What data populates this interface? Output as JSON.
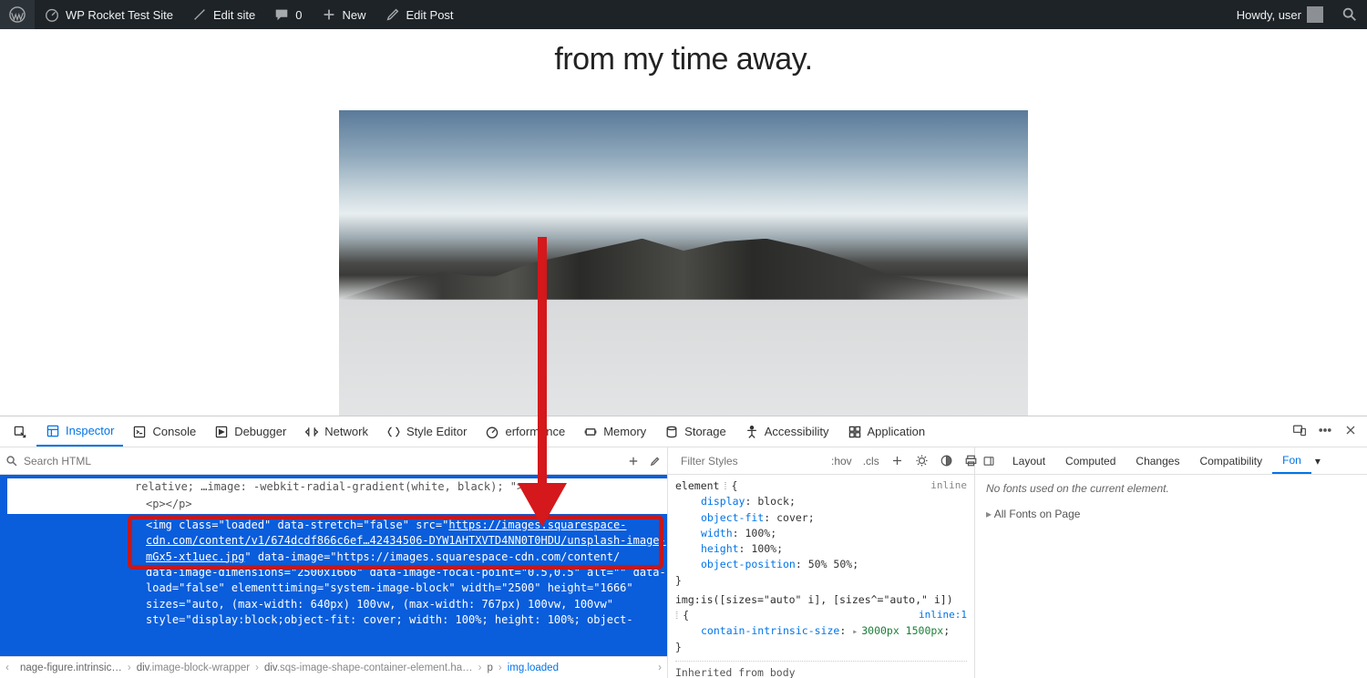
{
  "admin_bar": {
    "site_name": "WP Rocket Test Site",
    "edit_site": "Edit site",
    "comments_count": "0",
    "new_label": "New",
    "edit_post": "Edit Post",
    "howdy": "Howdy, user"
  },
  "page": {
    "headline": "from my time away."
  },
  "devtools": {
    "tabs": [
      "Inspector",
      "Console",
      "Debugger",
      "Network",
      "Style Editor",
      "erformance",
      "Memory",
      "Storage",
      "Accessibility",
      "Application"
    ],
    "active_tab": "Inspector",
    "search_placeholder": "Search HTML",
    "html_lines": {
      "prefix_line": "relative; …image: -webkit-radial-gradient(white, black); \">",
      "pline": "<p></p>",
      "sel_l1a": "<img class=\"loaded\" data-stretch=\"false\" src=\"",
      "sel_url1": "https://images.squarespace-cdn.com/content/v1/674dcdf866c6ef…42434506-DYW1AHTXVTD4NN0T0HDU/unsplash-image-mGx5-xt1uec.jpg",
      "sel_l1b": "\" data-image=\"https://images.squarespace-cdn.com/content/",
      "tail_l1": "data-image-dimensions=\"2500x1666\" data-image-focal-point=\"0.5,0.5\" alt=\"\" data-",
      "tail_l2": "load=\"false\" elementtiming=\"system-image-block\" width=\"2500\" height=\"1666\"",
      "tail_l3": "sizes=\"auto, (max-width: 640px) 100vw, (max-width: 767px) 100vw, 100vw\"",
      "tail_l4": "style=\"display:block;object-fit: cover; width: 100%; height: 100%; object-"
    },
    "breadcrumbs": [
      {
        "text": "nage-figure.intrinsic…",
        "cls": ""
      },
      {
        "text": "div",
        "cls": ".image-block-wrapper"
      },
      {
        "text": "div",
        "cls": ".sqs-image-shape-container-element.ha…"
      },
      {
        "text": "p",
        "cls": ""
      },
      {
        "text": "img",
        "cls": ".loaded"
      }
    ],
    "styles": {
      "filter_placeholder": "Filter Styles",
      "hov": ":hov",
      "cls": ".cls",
      "rule1": {
        "selector": "element",
        "source": "inline",
        "decls": [
          {
            "p": "display",
            "v": "block"
          },
          {
            "p": "object-fit",
            "v": "cover"
          },
          {
            "p": "width",
            "v": "100%"
          },
          {
            "p": "height",
            "v": "100%"
          },
          {
            "p": "object-position",
            "v": "50% 50%"
          }
        ]
      },
      "rule2": {
        "selector": "img:is([sizes=\"auto\" i], [sizes^=\"auto,\" i])",
        "source": "inline:1",
        "decls": [
          {
            "p": "contain-intrinsic-size",
            "v": "3000px 1500px",
            "tri": true
          }
        ]
      },
      "inherited_from": "Inherited from body"
    },
    "right": {
      "tabs": [
        "Layout",
        "Computed",
        "Changes",
        "Compatibility",
        "Fon"
      ],
      "active": "Fon",
      "no_fonts": "No fonts used on the current element.",
      "all_fonts": "All Fonts on Page"
    }
  }
}
